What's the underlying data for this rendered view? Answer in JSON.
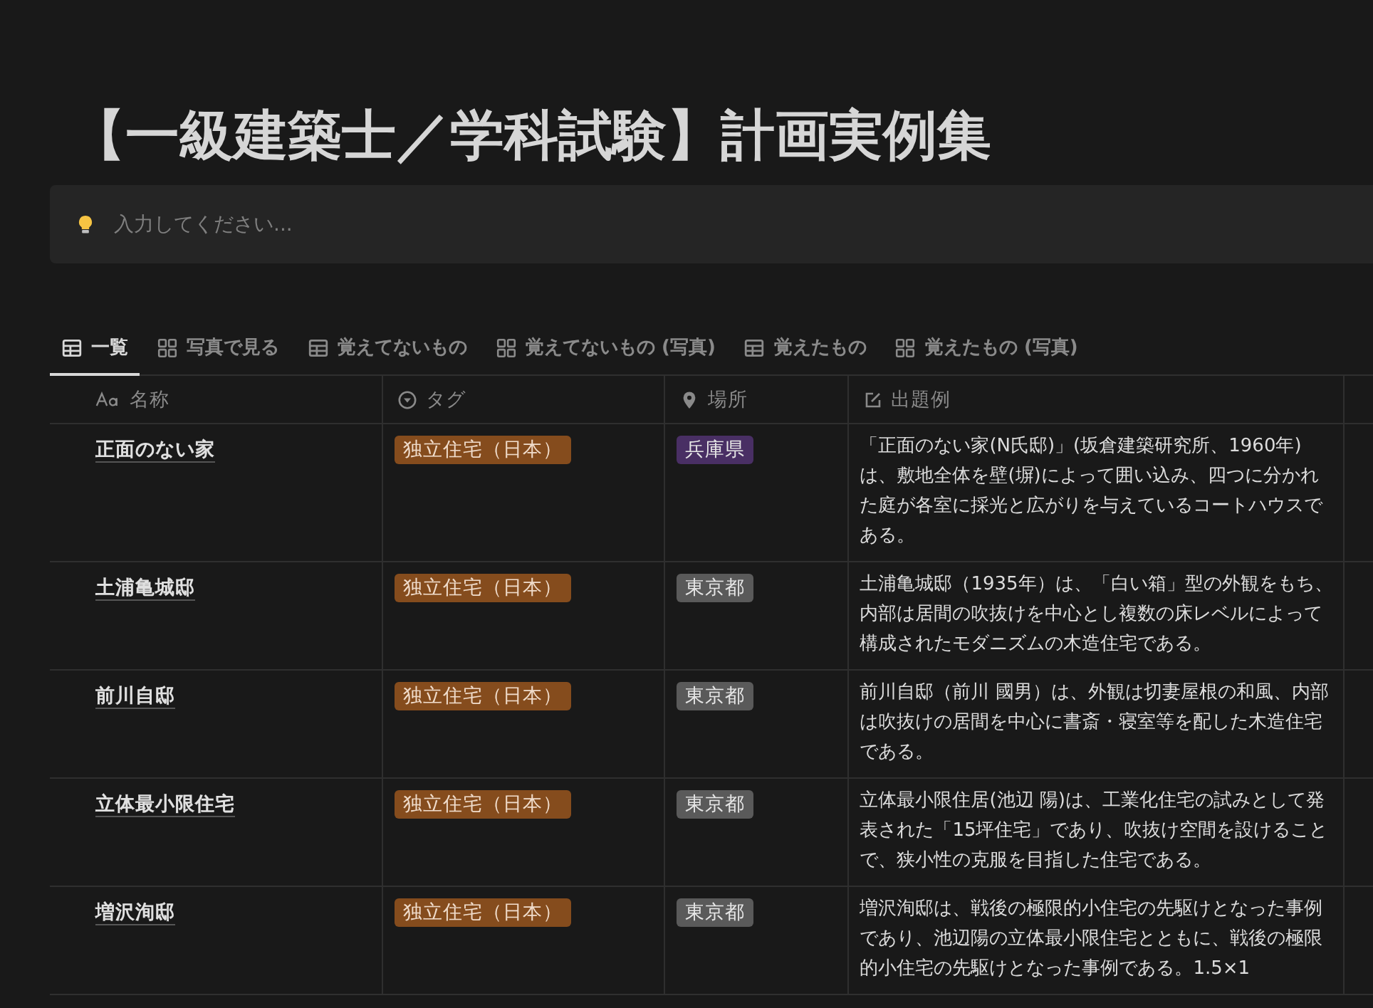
{
  "page": {
    "title": "【一級建築士／学科試験】計画実例集"
  },
  "callout": {
    "placeholder": "入力してください..."
  },
  "tabs": [
    {
      "label": "一覧",
      "kind": "table",
      "selected": true
    },
    {
      "label": "写真で見る",
      "kind": "gallery",
      "selected": false
    },
    {
      "label": "覚えてないもの",
      "kind": "table",
      "selected": false
    },
    {
      "label": "覚えてないもの (写真)",
      "kind": "gallery",
      "selected": false
    },
    {
      "label": "覚えたもの",
      "kind": "table",
      "selected": false
    },
    {
      "label": "覚えたもの (写真)",
      "kind": "gallery",
      "selected": false
    }
  ],
  "table": {
    "columns": [
      {
        "label": "名称",
        "kind": "title"
      },
      {
        "label": "タグ",
        "kind": "select"
      },
      {
        "label": "場所",
        "kind": "place"
      },
      {
        "label": "出題例",
        "kind": "text"
      }
    ],
    "rows": [
      {
        "name": "正面のない家",
        "tag": {
          "text": "独立住宅（日本）",
          "color": "#854c1d"
        },
        "place": {
          "text": "兵庫県",
          "color": "#492f64"
        },
        "example": "「正面のない家(N氏邸)」(坂倉建築研究所、1960年)は、敷地全体を壁(塀)によって囲い込み、四つに分かれた庭が各室に採光と広がりを与えているコートハウスである。"
      },
      {
        "name": "土浦亀城邸",
        "tag": {
          "text": "独立住宅（日本）",
          "color": "#854c1d"
        },
        "place": {
          "text": "東京都",
          "color": "#5a5a5a"
        },
        "example": "土浦亀城邸（1935年）は、「白い箱」型の外観をもち、内部は居間の吹抜けを中心とし複数の床レベルによって構成されたモダニズムの木造住宅である。"
      },
      {
        "name": "前川自邸",
        "tag": {
          "text": "独立住宅（日本）",
          "color": "#854c1d"
        },
        "place": {
          "text": "東京都",
          "color": "#5a5a5a"
        },
        "example": "前川自邸（前川 國男）は、外観は切妻屋根の和風、内部は吹抜けの居間を中心に書斎・寝室等を配した木造住宅である。"
      },
      {
        "name": "立体最小限住宅",
        "tag": {
          "text": "独立住宅（日本）",
          "color": "#854c1d"
        },
        "place": {
          "text": "東京都",
          "color": "#5a5a5a"
        },
        "example": "立体最小限住居(池辺 陽)は、工業化住宅の試みとして発表された「15坪住宅」であり、吹抜け空間を設けることで、狭小性の克服を目指した住宅である。"
      },
      {
        "name": "増沢洵邸",
        "tag": {
          "text": "独立住宅（日本）",
          "color": "#854c1d"
        },
        "place": {
          "text": "東京都",
          "color": "#5a5a5a"
        },
        "example": "増沢洵邸は、戦後の極限的小住宅の先駆けとなった事例であり、池辺陽の立体最小限住宅とともに、戦後の極限的小住宅の先駆けとなった事例である。1.5×1"
      }
    ]
  }
}
